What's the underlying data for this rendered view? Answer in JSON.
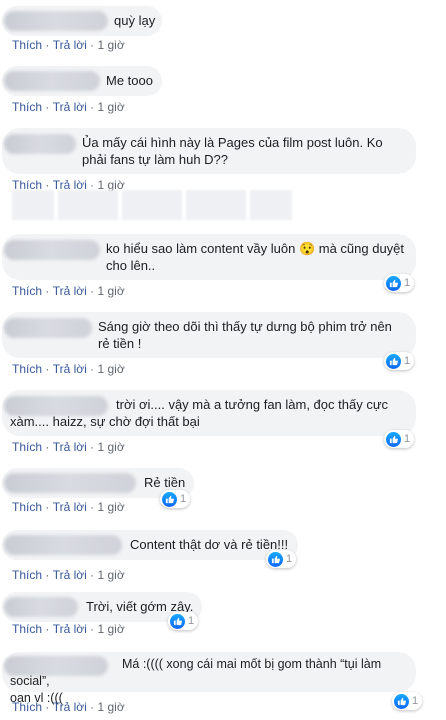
{
  "meta": {
    "like": "Thích",
    "reply": "Trả lời",
    "sep": "·"
  },
  "comments": [
    {
      "text": "quỳ lạy",
      "time": "1 giờ",
      "likes": ""
    },
    {
      "text": "Me tooo",
      "time": "1 giờ",
      "likes": ""
    },
    {
      "text": "Ủa mấy cái hình này là Pages của film post luôn. Ko\nphải fans tự làm huh D??",
      "time": "1 giờ",
      "likes": ""
    },
    {
      "text": "ko hiểu sao làm content vầy luôn 😯 mà cũng duyệt\ncho lên..",
      "time": "1 giờ",
      "likes": "1"
    },
    {
      "text": "Sáng giờ theo dõi thì thấy tự dưng bộ phim trở nên\nrẻ tiền !",
      "time": "1 giờ",
      "likes": "1"
    },
    {
      "text": "trời ơi.... vậy mà a tưởng fan làm, đọc thấy cực\nxàm.... haizz, sự chờ đợi thất bại",
      "time": "1 giờ",
      "likes": "1"
    },
    {
      "text": "Rẻ tiền",
      "time": "1 giờ",
      "likes": "1"
    },
    {
      "text": "Content thật dơ và rẻ tiền!!!",
      "time": "1 giờ",
      "likes": "1"
    },
    {
      "text": "Trời, viết gớm zây.",
      "time": "1 giờ",
      "likes": "1"
    },
    {
      "text": "Má :(((( xong cái mai mốt bị gom thành “tụi làm social”,\noan vl :(((",
      "time": "1 giờ",
      "likes": "1"
    }
  ]
}
